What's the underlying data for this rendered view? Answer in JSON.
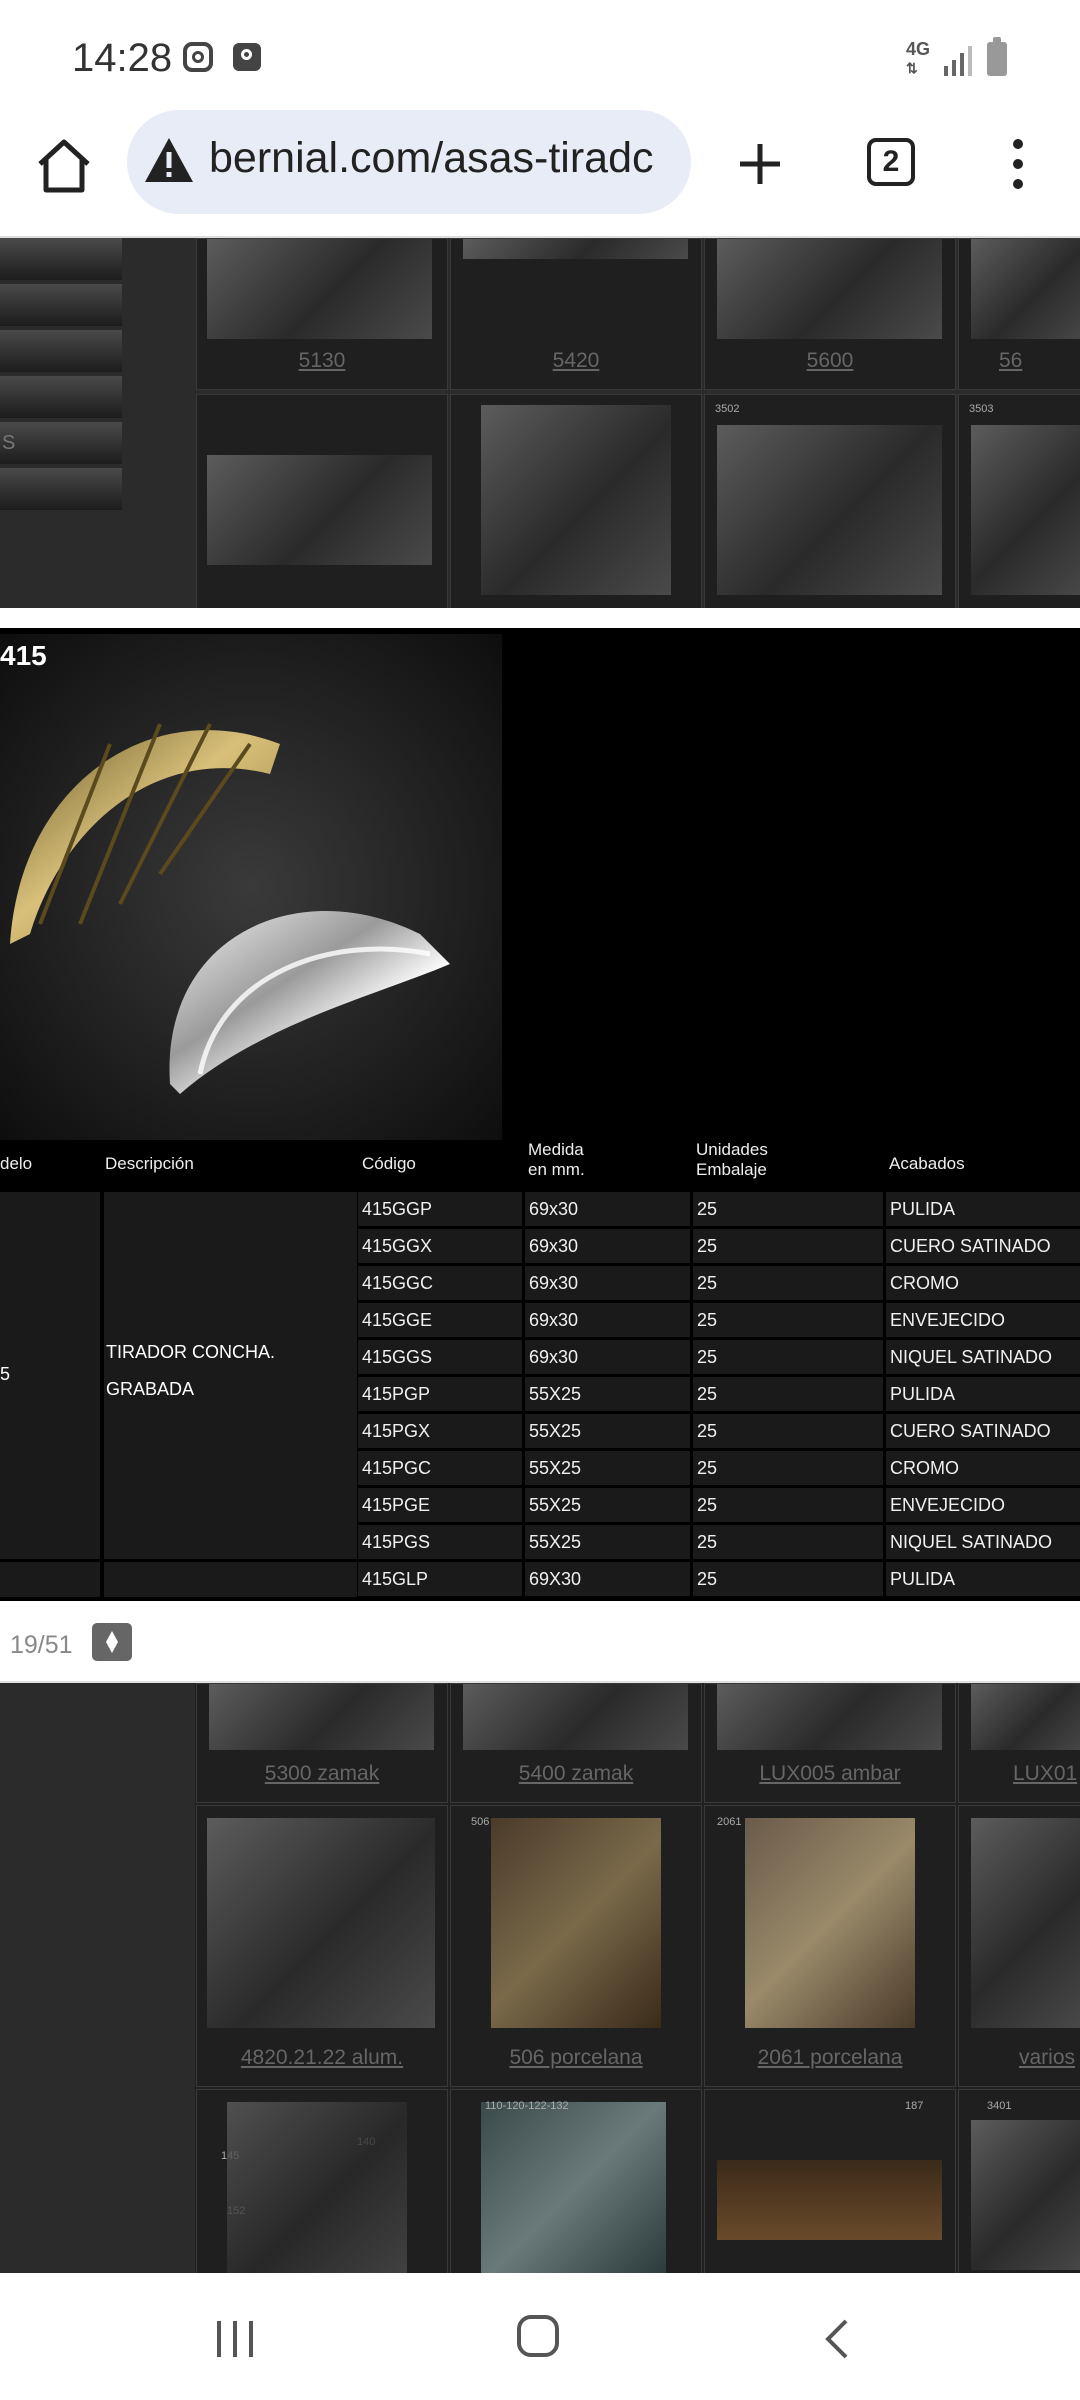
{
  "status_bar": {
    "time": "14:28",
    "network": "4G"
  },
  "browser": {
    "url": "bernial.com/asas-tiradc",
    "tab_count": "2"
  },
  "top_gallery": {
    "side_menu_partial": "S",
    "items": [
      {
        "label": "5130"
      },
      {
        "label": "5420"
      },
      {
        "label": "5600"
      },
      {
        "label": "56"
      }
    ],
    "row2_numbers": [
      "3502",
      "3503"
    ]
  },
  "catalog": {
    "model_number": "415",
    "headers": {
      "modelo": "delo",
      "descripcion": "Descripción",
      "codigo": "Código",
      "medida_1": "Medida",
      "medida_2": "en mm.",
      "unidades_1": "Unidades",
      "unidades_2": "Embalaje",
      "acabados": "Acabados"
    },
    "model_cell": "5",
    "description_line1": "TIRADOR CONCHA.",
    "description_line2": "GRABADA",
    "rows": [
      {
        "codigo": "415GGP",
        "medida": "69x30",
        "unidades": "25",
        "acabado": "PULIDA"
      },
      {
        "codigo": "415GGX",
        "medida": "69x30",
        "unidades": "25",
        "acabado": "CUERO SATINADO"
      },
      {
        "codigo": "415GGC",
        "medida": "69x30",
        "unidades": "25",
        "acabado": "CROMO"
      },
      {
        "codigo": "415GGE",
        "medida": "69x30",
        "unidades": "25",
        "acabado": "ENVEJECIDO"
      },
      {
        "codigo": "415GGS",
        "medida": "69x30",
        "unidades": "25",
        "acabado": "NIQUEL SATINADO"
      },
      {
        "codigo": "415PGP",
        "medida": "55X25",
        "unidades": "25",
        "acabado": "PULIDA"
      },
      {
        "codigo": "415PGX",
        "medida": "55X25",
        "unidades": "25",
        "acabado": "CUERO SATINADO"
      },
      {
        "codigo": "415PGC",
        "medida": "55X25",
        "unidades": "25",
        "acabado": "CROMO"
      },
      {
        "codigo": "415PGE",
        "medida": "55X25",
        "unidades": "25",
        "acabado": "ENVEJECIDO"
      },
      {
        "codigo": "415PGS",
        "medida": "55X25",
        "unidades": "25",
        "acabado": "NIQUEL SATINADO"
      },
      {
        "codigo": "415GLP",
        "medida": "69X30",
        "unidades": "25",
        "acabado": "PULIDA"
      }
    ]
  },
  "pager": {
    "text": "19/51"
  },
  "bottom_gallery": {
    "row1": [
      {
        "label": "5300 zamak"
      },
      {
        "label": "5400 zamak"
      },
      {
        "label": "LUX005 ambar"
      },
      {
        "label": "LUX01"
      }
    ],
    "row2": [
      {
        "label": "4820.21.22 alum."
      },
      {
        "label": "506 porcelana"
      },
      {
        "label": "2061 porcelana"
      },
      {
        "label": "varios"
      }
    ],
    "row2_numbers": [
      "506",
      "2061"
    ],
    "row3_numbers": [
      "145",
      "140",
      "152",
      "110-120-122-132",
      "187",
      "3401"
    ]
  }
}
